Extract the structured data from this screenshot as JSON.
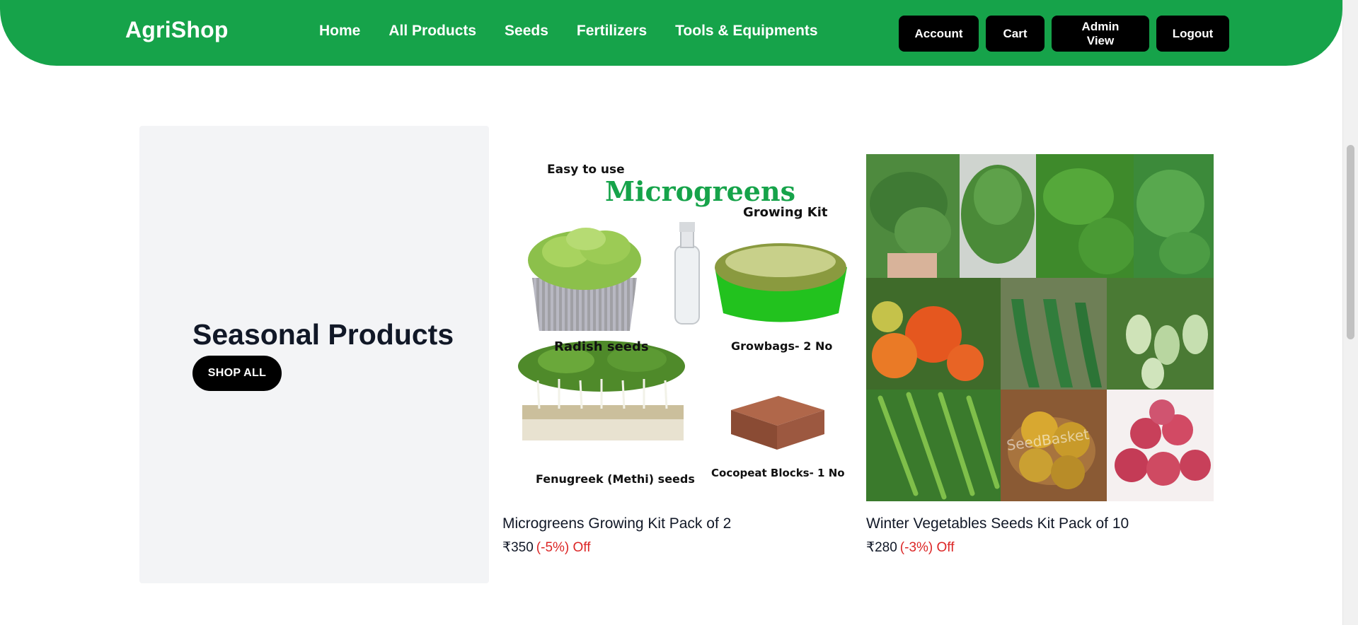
{
  "header": {
    "logo": "AgriShop",
    "nav": [
      "Home",
      "All Products",
      "Seeds",
      "Fertilizers",
      "Tools & Equipments"
    ],
    "actions": [
      "Account",
      "Cart",
      "Admin View",
      "Logout"
    ],
    "brand_color": "#16a34a"
  },
  "seasonal": {
    "title": "Seasonal Products",
    "cta": "SHOP ALL"
  },
  "products": [
    {
      "name": "Microgreens Growing Kit Pack of 2",
      "price": "₹350",
      "discount": "(-5%) Off",
      "image_text": {
        "easy": "Easy to use",
        "headline": "Microgreens",
        "sub": "Growing Kit",
        "radish": "Radish seeds",
        "growbags": "Growbags- 2 No",
        "fenugreek": "Fenugreek (Methi) seeds",
        "cocopeat": "Cocopeat Blocks- 1 No"
      }
    },
    {
      "name": "Winter Vegetables Seeds Kit Pack of 10",
      "price": "₹280",
      "discount": "(-3%) Off",
      "image_text": {
        "watermark": "SeedBasket"
      }
    }
  ],
  "colors": {
    "discount": "#dc2626",
    "panel_bg": "#f3f4f6"
  }
}
